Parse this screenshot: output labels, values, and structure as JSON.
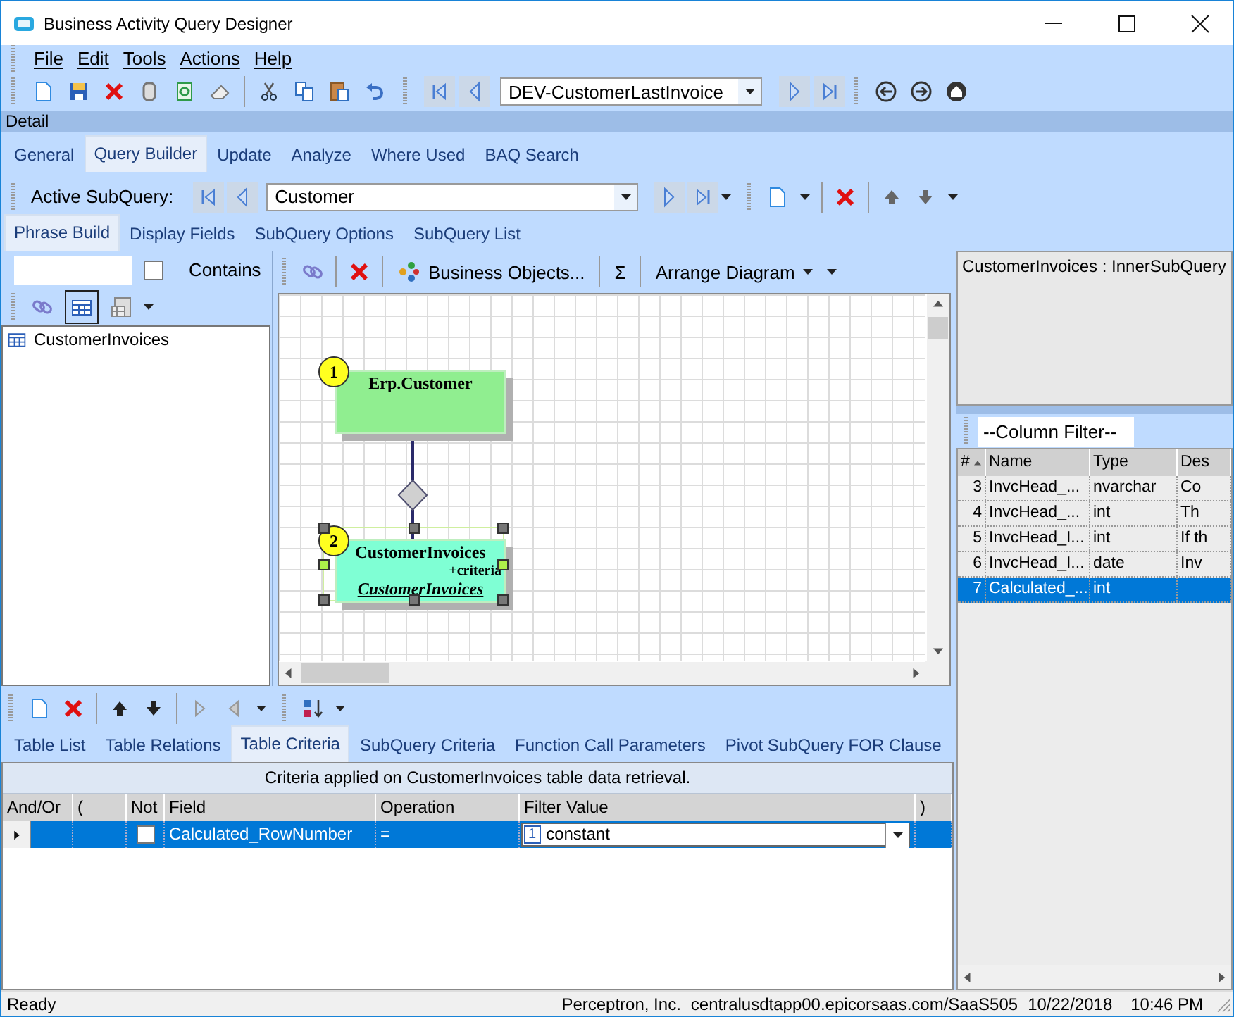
{
  "window": {
    "title": "Business Activity Query Designer"
  },
  "menu": [
    "File",
    "Edit",
    "Tools",
    "Actions",
    "Help"
  ],
  "toolbar": {
    "query_id": "DEV-CustomerLastInvoice"
  },
  "section_label": "Detail",
  "tabs": [
    {
      "label": "General",
      "selected": false
    },
    {
      "label": "Query Builder",
      "selected": true
    },
    {
      "label": "Update",
      "selected": false
    },
    {
      "label": "Analyze",
      "selected": false
    },
    {
      "label": "Where Used",
      "selected": false
    },
    {
      "label": "BAQ Search",
      "selected": false
    }
  ],
  "subquery_toolbar": {
    "label": "Active SubQuery:",
    "value": "Customer"
  },
  "subtabs": [
    {
      "label": "Phrase Build",
      "selected": true
    },
    {
      "label": "Display Fields",
      "selected": false
    },
    {
      "label": "SubQuery Options",
      "selected": false
    },
    {
      "label": "SubQuery List",
      "selected": false
    }
  ],
  "table_search": {
    "contains_label": "Contains",
    "contains_checked": false
  },
  "tables": [
    "CustomerInvoices"
  ],
  "diagram_toolbar": {
    "business_objects": "Business Objects...",
    "sigma": "Σ",
    "arrange": "Arrange Diagram"
  },
  "diagram": {
    "nodes": [
      {
        "number": "1",
        "title": "Erp.Customer",
        "color": "#90ee90",
        "selected": false
      },
      {
        "number": "2",
        "title": "CustomerInvoices",
        "criteria": "+criteria",
        "alias": "CustomerInvoices",
        "color": "#7fffd4",
        "selected": true
      }
    ]
  },
  "subquery_info": "CustomerInvoices : InnerSubQuery",
  "column_filter": "--Column Filter--",
  "columns_table": {
    "columns": [
      "#",
      "Name",
      "Type",
      "Des"
    ],
    "rows": [
      {
        "cells": [
          "3",
          "InvcHead_...",
          "nvarchar",
          "Co"
        ],
        "selected": false
      },
      {
        "cells": [
          "4",
          "InvcHead_...",
          "int",
          "Th"
        ],
        "selected": false
      },
      {
        "cells": [
          "5",
          "InvcHead_I...",
          "int",
          "If th"
        ],
        "selected": false
      },
      {
        "cells": [
          "6",
          "InvcHead_I...",
          "date",
          "Inv"
        ],
        "selected": false
      },
      {
        "cells": [
          "7",
          "Calculated_...",
          "int",
          ""
        ],
        "selected": true
      }
    ]
  },
  "bottom_tabs": [
    {
      "label": "Table List",
      "selected": false
    },
    {
      "label": "Table Relations",
      "selected": false
    },
    {
      "label": "Table Criteria",
      "selected": true
    },
    {
      "label": "SubQuery Criteria",
      "selected": false
    },
    {
      "label": "Function Call Parameters",
      "selected": false
    },
    {
      "label": "Pivot SubQuery FOR Clause",
      "selected": false
    }
  ],
  "criteria": {
    "caption": "Criteria applied on CustomerInvoices table data retrieval.",
    "columns": [
      "And/Or",
      "(",
      "Not",
      "Field",
      "Operation",
      "Filter Value",
      ")"
    ],
    "rows": [
      {
        "selected": true,
        "not_checked": false,
        "field": "Calculated_RowNumber",
        "operation": "=",
        "value_kind": "1",
        "filter_value": "constant"
      }
    ]
  },
  "status_bar": {
    "state": "Ready",
    "company": "Perceptron, Inc.",
    "server": "centralusdtapp00.epicorsaas.com/SaaS505",
    "date": "10/22/2018",
    "time": "10:46 PM"
  }
}
